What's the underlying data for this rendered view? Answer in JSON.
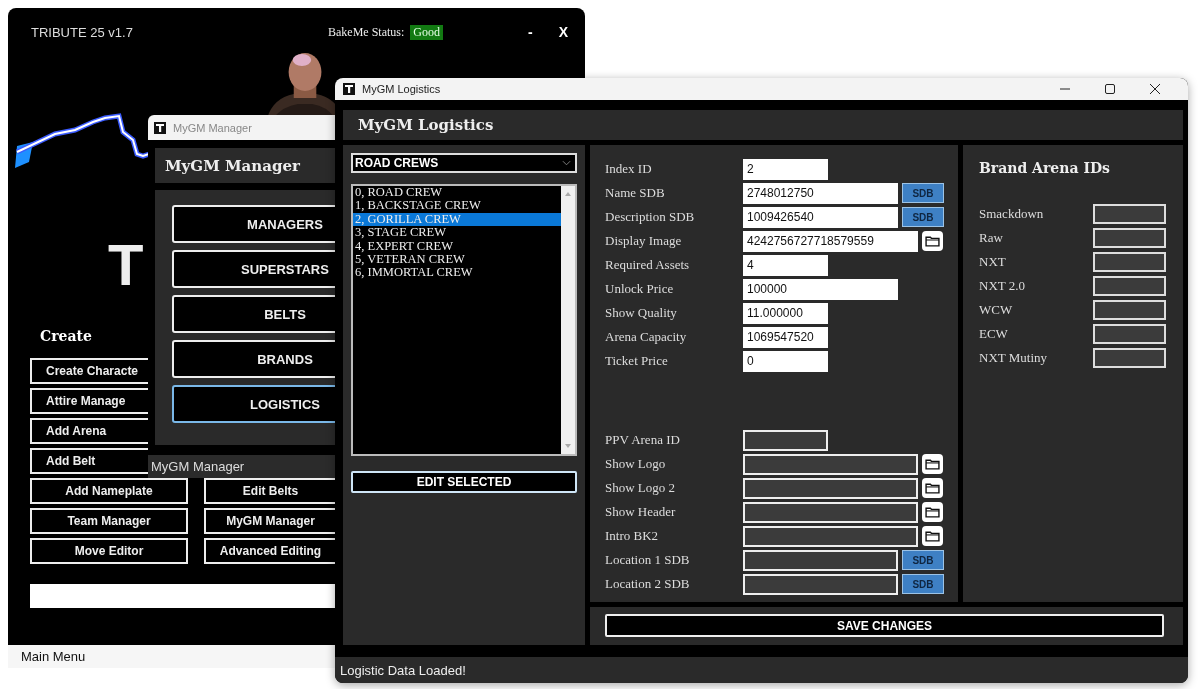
{
  "main_window": {
    "title": "TRIBUTE 25 v1.7",
    "status_label": "BakeMe Status:",
    "status_value": "Good",
    "minimize": "-",
    "close": "X",
    "logo_letter": "T",
    "section_heading": "Create",
    "left_buttons": [
      "Create Characte",
      "Attire Manage",
      "Add Arena",
      "Add Belt",
      "Add Nameplate",
      "Team Manager",
      "Move Editor"
    ],
    "right_buttons": [
      "Edit Belts",
      "MyGM Manager",
      "Advanced Editing"
    ],
    "status_bar": "Main Menu"
  },
  "manager_window": {
    "title": "MyGM Manager",
    "heading": "MyGM Manager",
    "buttons": [
      {
        "label": "MANAGERS",
        "selected": false
      },
      {
        "label": "SUPERSTARS",
        "selected": false
      },
      {
        "label": "BELTS",
        "selected": false
      },
      {
        "label": "BRANDS",
        "selected": false
      },
      {
        "label": "LOGISTICS",
        "selected": true
      }
    ],
    "status_bar": "MyGM Manager"
  },
  "logistics_window": {
    "title": "MyGM Logistics",
    "heading": "MyGM Logistics",
    "category_dropdown": "ROAD CREWS",
    "crews": [
      {
        "label": "0, ROAD CREW",
        "selected": false
      },
      {
        "label": "1, BACKSTAGE CREW",
        "selected": false
      },
      {
        "label": "2, GORILLA CREW",
        "selected": true
      },
      {
        "label": "3, STAGE CREW",
        "selected": false
      },
      {
        "label": "4, EXPERT CREW",
        "selected": false
      },
      {
        "label": "5, VETERAN CREW",
        "selected": false
      },
      {
        "label": "6, IMMORTAL CREW",
        "selected": false
      }
    ],
    "edit_button": "EDIT SELECTED",
    "fields": [
      {
        "label": "Index ID",
        "value": "2",
        "kind": "plain"
      },
      {
        "label": "Name SDB",
        "value": "2748012750",
        "kind": "sdb",
        "button": "SDB"
      },
      {
        "label": "Description SDB",
        "value": "1009426540",
        "kind": "sdb",
        "button": "SDB"
      },
      {
        "label": "Display Image",
        "value": "4242756727718579559",
        "kind": "browse"
      },
      {
        "label": "Required Assets",
        "value": "4",
        "kind": "plain"
      },
      {
        "label": "Unlock Price",
        "value": "100000",
        "kind": "plain"
      },
      {
        "label": "Show Quality",
        "value": "11.000000",
        "kind": "plain"
      },
      {
        "label": "Arena Capacity",
        "value": "1069547520",
        "kind": "plain"
      },
      {
        "label": "Ticket Price",
        "value": "0",
        "kind": "plain"
      }
    ],
    "asset_fields": [
      {
        "label": "PPV Arena ID",
        "kind": "plain"
      },
      {
        "label": "Show Logo",
        "kind": "browse"
      },
      {
        "label": "Show Logo 2",
        "kind": "browse"
      },
      {
        "label": "Show Header",
        "kind": "browse"
      },
      {
        "label": "Intro BK2",
        "kind": "browse"
      },
      {
        "label": "Location 1 SDB",
        "kind": "sdb",
        "button": "SDB"
      },
      {
        "label": "Location 2 SDB",
        "kind": "sdb",
        "button": "SDB"
      }
    ],
    "brand_heading": "Brand Arena IDs",
    "brands": [
      {
        "label": "Smackdown"
      },
      {
        "label": "Raw"
      },
      {
        "label": "NXT"
      },
      {
        "label": "NXT 2.0"
      },
      {
        "label": "WCW"
      },
      {
        "label": "ECW"
      },
      {
        "label": "NXT Mutiny"
      }
    ],
    "save_button": "SAVE CHANGES",
    "status_bar": "Logistic Data Loaded!"
  }
}
